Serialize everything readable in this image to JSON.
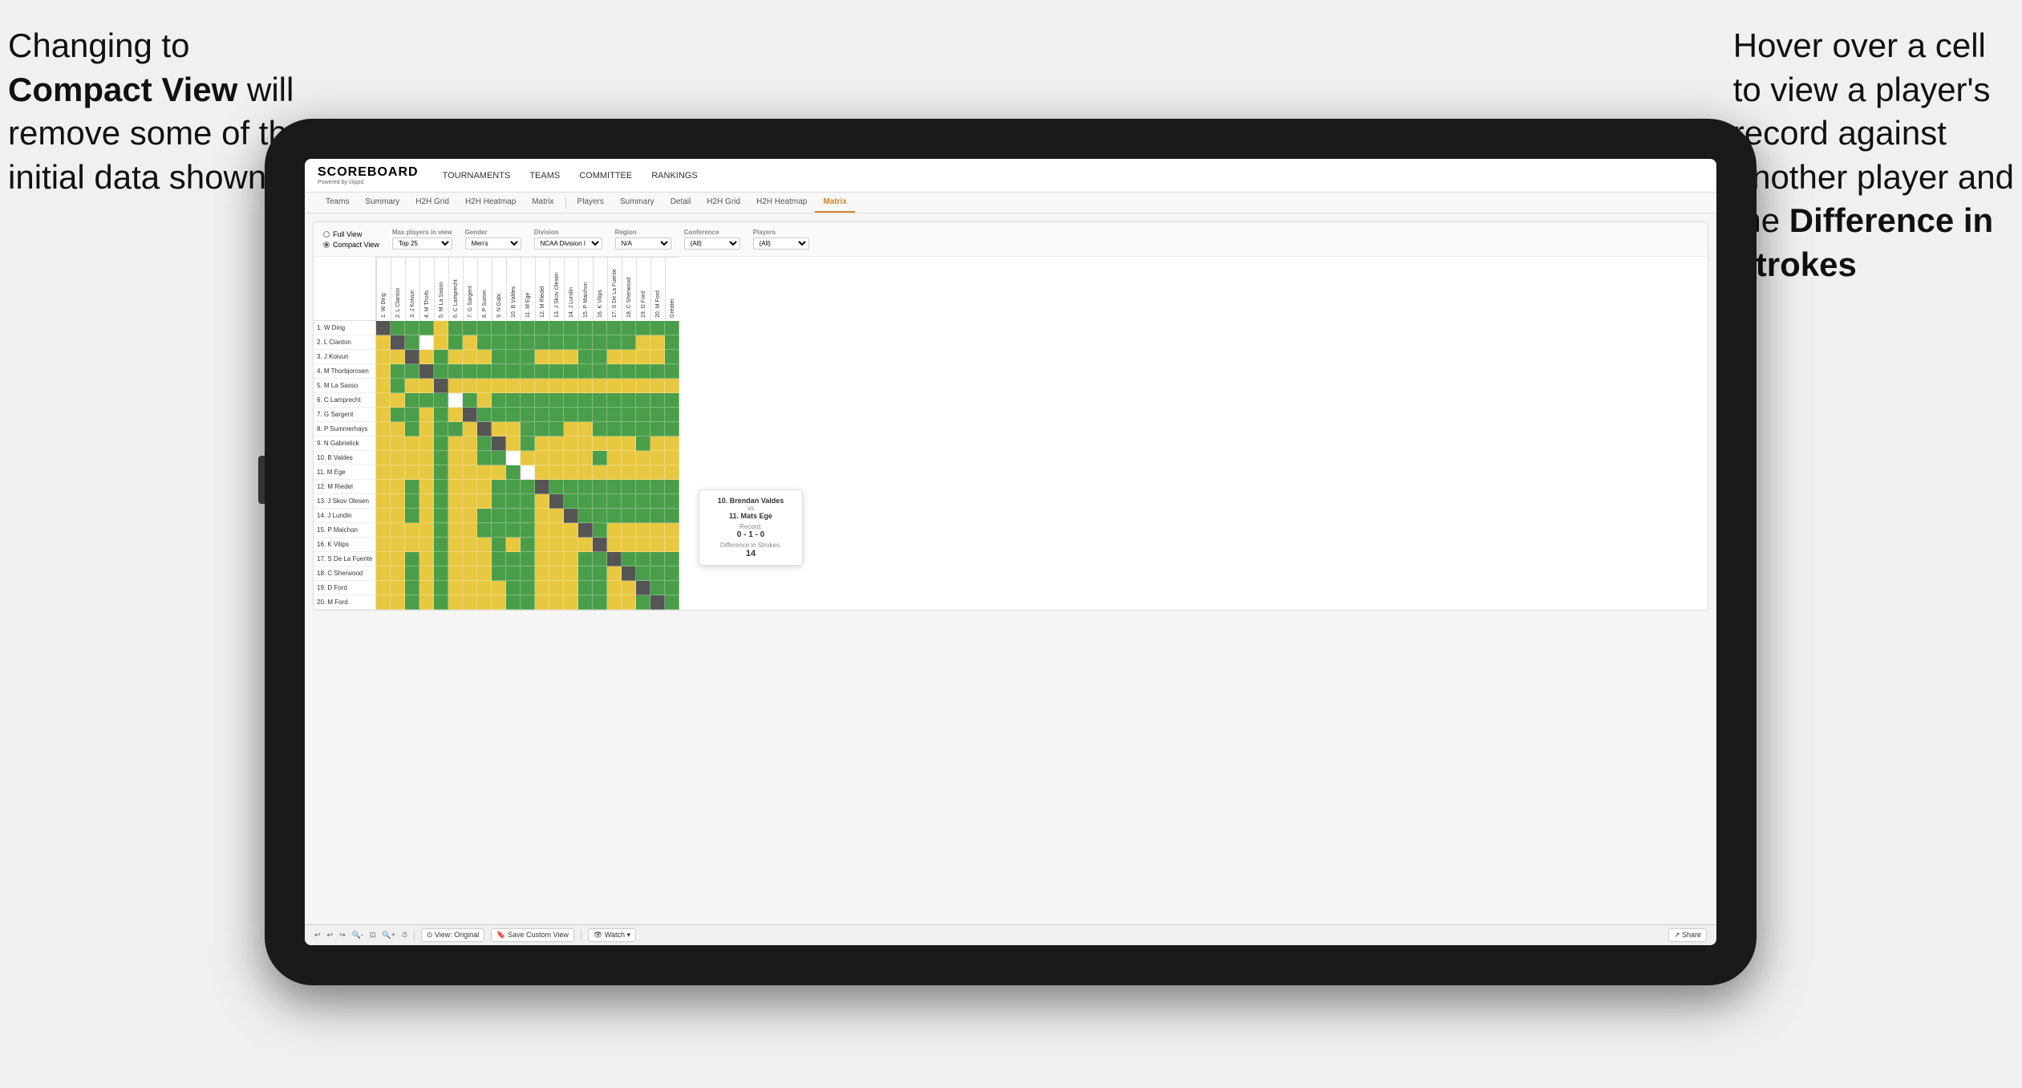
{
  "annotations": {
    "left": {
      "line1": "Changing to",
      "line2": "Compact View will",
      "line3": "remove some of the",
      "line4": "initial data shown"
    },
    "right": {
      "line1": "Hover over a cell",
      "line2": "to view a player's",
      "line3": "record against",
      "line4": "another player and",
      "line5": "the ",
      "line5b": "Difference in",
      "line6": "Strokes"
    }
  },
  "navbar": {
    "logo": "SCOREBOARD",
    "logo_sub": "Powered by clippd",
    "nav_items": [
      "TOURNAMENTS",
      "TEAMS",
      "COMMITTEE",
      "RANKINGS"
    ]
  },
  "sub_tabs_left": [
    "Teams",
    "Summary",
    "H2H Grid",
    "H2H Heatmap",
    "Matrix"
  ],
  "sub_tabs_right": [
    "Players",
    "Summary",
    "Detail",
    "H2H Grid",
    "H2H Heatmap",
    "Matrix"
  ],
  "filters": {
    "view_options": [
      "Full View",
      "Compact View"
    ],
    "max_players_label": "Max players in view",
    "max_players_value": "Top 25",
    "gender_label": "Gender",
    "gender_value": "Men's",
    "division_label": "Division",
    "division_value": "NCAA Division I",
    "region_label": "Region",
    "region_value": "N/A",
    "conference_label": "Conference",
    "conference_value": "(All)",
    "players_label": "Players",
    "players_value": "(All)"
  },
  "players": [
    "1. W Ding",
    "2. L Clanton",
    "3. J Koivun",
    "4. M Thorbjornsen",
    "5. M La Sasso",
    "6. C Lamprecht",
    "7. G Sargent",
    "8. P Summerhays",
    "9. N Gabrielick",
    "10. B Valdes",
    "11. M Ege",
    "12. M Riedel",
    "13. J Skov Olesen",
    "14. J Lundin",
    "15. P Maichon",
    "16. K Vilips",
    "17. S De La Fuente",
    "18. C Sherwood",
    "19. D Ford",
    "20. M Ford"
  ],
  "col_headers": [
    "1. W Ding",
    "2. L Clanton",
    "3. J Koivun",
    "4. M Thorb.",
    "5. M La Sasso",
    "6. C Lamprecht",
    "7. G Sargent",
    "8. P Summ.",
    "9. N Gabr.",
    "10. B Valdes",
    "11. M Ege",
    "12. M Riedel",
    "13. J Skov Olesen",
    "14. J Lundin",
    "15. P Maichon",
    "16. K Vilips",
    "17. S De La Fuente",
    "18. C Sherwood",
    "19. D Ford",
    "20. M Ford",
    "Greater"
  ],
  "tooltip": {
    "player1": "10. Brendan Valdes",
    "vs": "vs",
    "player2": "11. Mats Ege",
    "record_label": "Record:",
    "record": "0 - 1 - 0",
    "diff_label": "Difference in Strokes:",
    "diff": "14"
  },
  "toolbar": {
    "undo": "↩",
    "redo": "↪",
    "view_original": "⊙ View: Original",
    "save_custom": "🔖 Save Custom View",
    "watch": "👁 Watch ▾",
    "share": "↗ Share"
  }
}
